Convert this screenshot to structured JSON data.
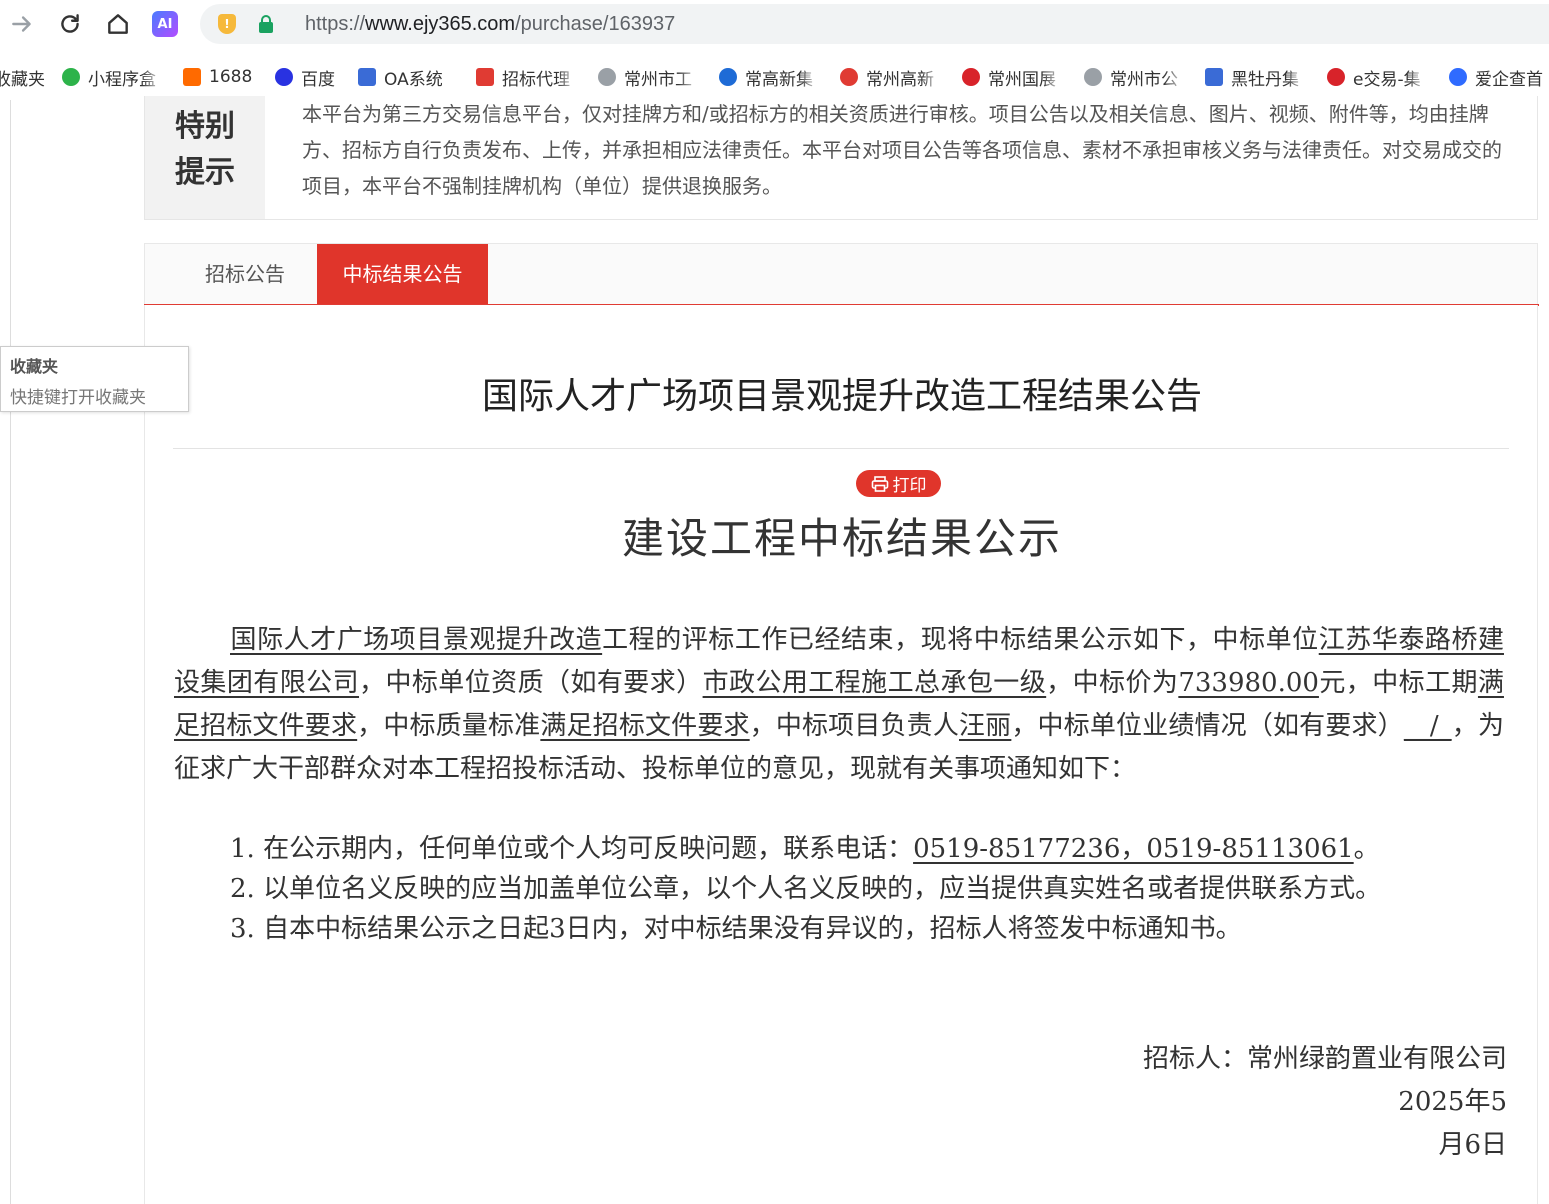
{
  "browser": {
    "url_prefix": "https://",
    "url_domain": "www.ejy365.com",
    "url_path": "/purchase/163937",
    "ai_label": "AI",
    "shield_label": "!"
  },
  "bookmarks": [
    {
      "label": "收藏夹",
      "color": "#555"
    },
    {
      "label": "小程序盒",
      "color": "#2db34a"
    },
    {
      "label": "1688",
      "color": "#ff6a00"
    },
    {
      "label": "百度",
      "color": "#2932e1"
    },
    {
      "label": "OA系统",
      "color": "#3a6bd6"
    },
    {
      "label": "招标代理",
      "color": "#e03b33"
    },
    {
      "label": "常州市工",
      "color": "#9aa0a6"
    },
    {
      "label": "常高新集",
      "color": "#1e6bd6"
    },
    {
      "label": "常州高新",
      "color": "#e03b33"
    },
    {
      "label": "常州国展",
      "color": "#d8232a"
    },
    {
      "label": "常州市公",
      "color": "#9aa0a6"
    },
    {
      "label": "黑牡丹集",
      "color": "#3a6bd6"
    },
    {
      "label": "e交易-集",
      "color": "#d8232a"
    },
    {
      "label": "爱企查首",
      "color": "#2f6bff"
    }
  ],
  "notice": {
    "label": "特别提示",
    "text": "本平台为第三方交易信息平台，仅对挂牌方和/或招标方的相关资质进行审核。项目公告以及相关信息、图片、视频、附件等，均由挂牌方、招标方自行负责发布、上传，并承担相应法律责任。本平台对项目公告等各项信息、素材不承担审核义务与法律责任。对交易成交的项目，本平台不强制挂牌机构（单位）提供退换服务。"
  },
  "tabs": [
    {
      "label": "招标公告",
      "active": false
    },
    {
      "label": "中标结果公告",
      "active": true
    }
  ],
  "doc": {
    "title": "国际人才广场项目景观提升改造工程结果公告",
    "print_label": "打印",
    "sub_title": "建设工程中标结果公示",
    "p": {
      "project": "国际人才广场项目景观提升改造",
      "t1": "工程的评标工作已经结束，现将中标结果公示如下，中标单位",
      "winner": "江苏华泰路桥建设集团有限公司",
      "t2": "，中标单位资质（如有要求）",
      "qualification": "市政公用工程施工总承包一级",
      "t3": "，中标价为",
      "price": "733980.00",
      "t4": "元，中标工期",
      "period": "满足招标文件要求",
      "t5": "，中标质量标准",
      "quality": "满足招标文件要求",
      "t6": "，中标项目负责人",
      "manager": "汪丽",
      "t7": "，中标单位业绩情况（如有要求）",
      "performance": "__/_",
      "t8": "，为征求广大干部群众对本工程招投标活动、投标单位的意见，现就有关事项通知如下："
    },
    "list": {
      "item1_prefix": "1. 在公示期内，任何单位或个人均可反映问题，联系电话：",
      "item1_phone": "0519-85177236，0519-85113061",
      "item1_suffix": "。",
      "item2": "2. 以单位名义反映的应当加盖单位公章，以个人名义反映的，应当提供真实姓名或者提供联系方式。",
      "item3": "3. 自本中标结果公示之日起3日内，对中标结果没有异议的，招标人将签发中标通知书。"
    },
    "signer": "招标人：常州绿韵置业有限公司",
    "date_line1": "2025年5",
    "date_line2": "月6日"
  },
  "fav_tip": {
    "title": "收藏夹",
    "hint": "快捷键打开收藏夹"
  }
}
